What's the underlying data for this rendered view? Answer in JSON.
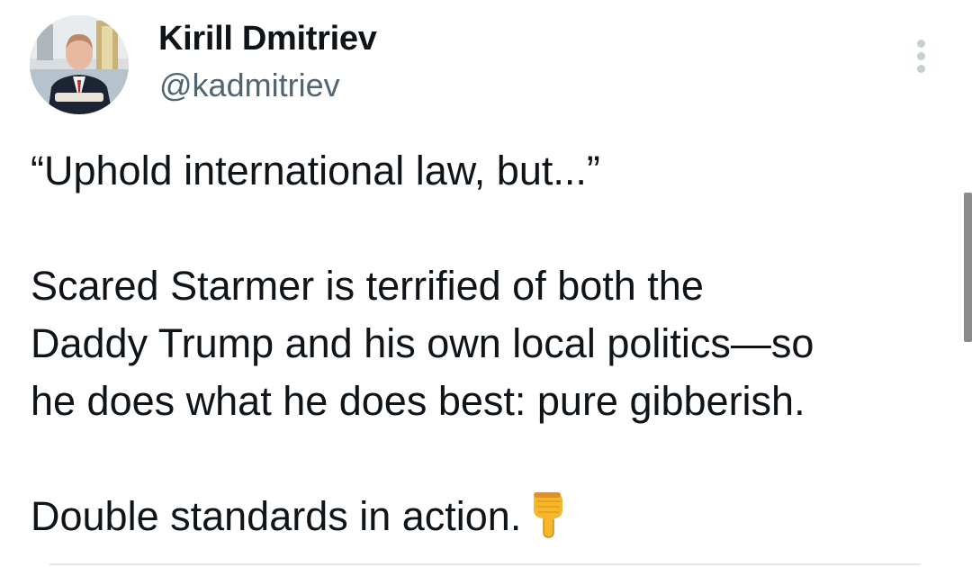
{
  "author": {
    "display_name": "Kirill Dmitriev",
    "handle": "@kadmitriev"
  },
  "tweet": {
    "paragraphs": [
      [
        "“Uphold international law, but...”"
      ],
      [
        "Scared Starmer is terrified of both the",
        "Daddy Trump and his own local politics—so",
        "he does what he does best: pure gibberish."
      ],
      [
        "Double standards in action."
      ]
    ],
    "trailing_emoji": "backhand-index-pointing-down-icon"
  },
  "colors": {
    "text": "#0f1419",
    "secondary_text": "#536471",
    "more_dots": "#c4cfd6",
    "emoji": "#f6b82a"
  }
}
